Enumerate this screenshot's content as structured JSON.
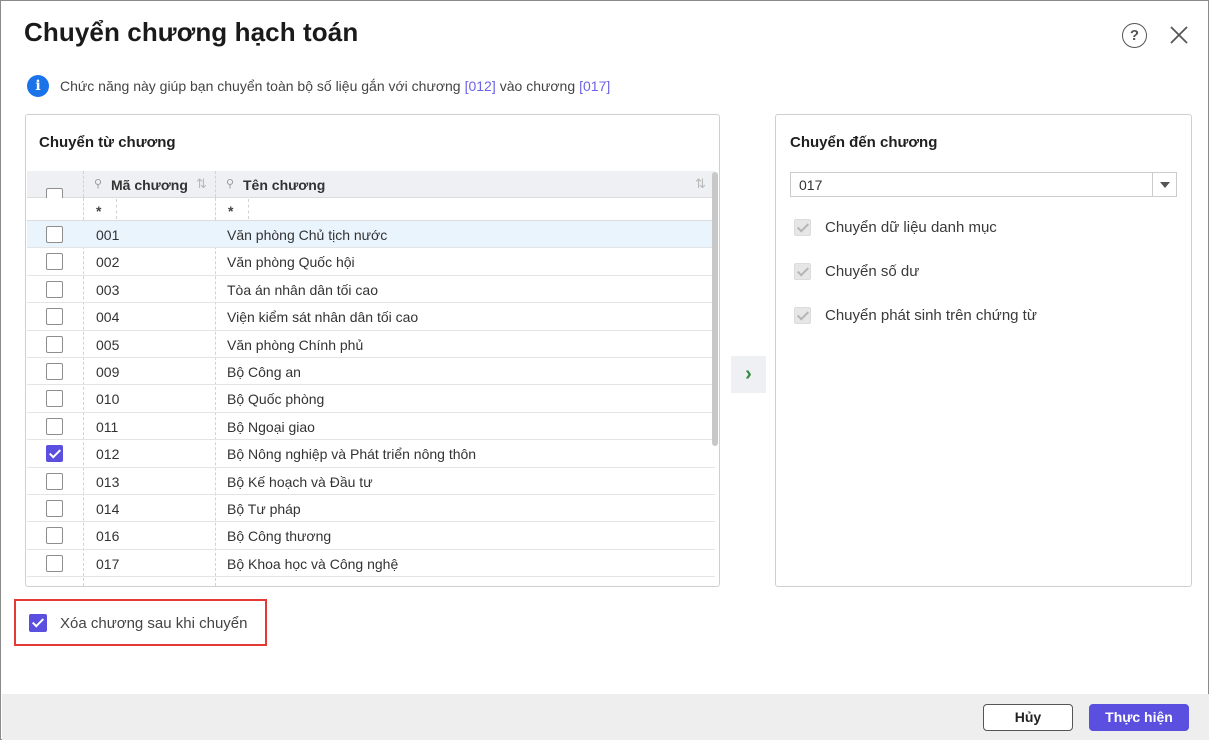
{
  "dialog": {
    "title": "Chuyển chương hạch toán",
    "info": {
      "text_before": "Chức năng này giúp bạn chuyển toàn bộ số liệu gắn với chương",
      "from_code": "[012]",
      "text_middle": "vào chương",
      "to_code": "[017]"
    }
  },
  "source_panel": {
    "title": "Chuyển từ chương",
    "columns": {
      "code": "Mã chương",
      "name": "Tên chương"
    },
    "filter": {
      "code": "*",
      "name": "*"
    },
    "rows": [
      {
        "code": "001",
        "name": "Văn phòng Chủ tịch nước",
        "checked": false
      },
      {
        "code": "002",
        "name": "Văn phòng Quốc hội",
        "checked": false
      },
      {
        "code": "003",
        "name": "Tòa án nhân dân tối cao",
        "checked": false
      },
      {
        "code": "004",
        "name": "Viện kiểm sát nhân dân tối cao",
        "checked": false
      },
      {
        "code": "005",
        "name": "Văn phòng Chính phủ",
        "checked": false
      },
      {
        "code": "009",
        "name": "Bộ Công an",
        "checked": false
      },
      {
        "code": "010",
        "name": "Bộ Quốc phòng",
        "checked": false
      },
      {
        "code": "011",
        "name": "Bộ Ngoại giao",
        "checked": false
      },
      {
        "code": "012",
        "name": "Bộ Nông nghiệp và Phát triển nông thôn",
        "checked": true
      },
      {
        "code": "013",
        "name": "Bộ Kế hoạch và Đầu tư",
        "checked": false
      },
      {
        "code": "014",
        "name": "Bộ Tư pháp",
        "checked": false
      },
      {
        "code": "016",
        "name": "Bộ Công thương",
        "checked": false
      },
      {
        "code": "017",
        "name": "Bộ Khoa học và Công nghệ",
        "checked": false
      }
    ]
  },
  "target_panel": {
    "title": "Chuyển đến chương",
    "selected_value": "017",
    "options": [
      {
        "label": "Chuyển dữ liệu danh mục",
        "checked": true
      },
      {
        "label": "Chuyển số dư",
        "checked": true
      },
      {
        "label": "Chuyển phát sinh trên chứng từ",
        "checked": true
      }
    ]
  },
  "delete_option": {
    "label": "Xóa chương sau khi chuyển",
    "checked": true
  },
  "footer": {
    "cancel_label": "Hủy",
    "execute_label": "Thực hiện"
  },
  "colors": {
    "accent": "#5b4fe0",
    "info": "#1a73e8",
    "highlight_border": "#e53935",
    "selected_row": "#e9f4fd"
  }
}
